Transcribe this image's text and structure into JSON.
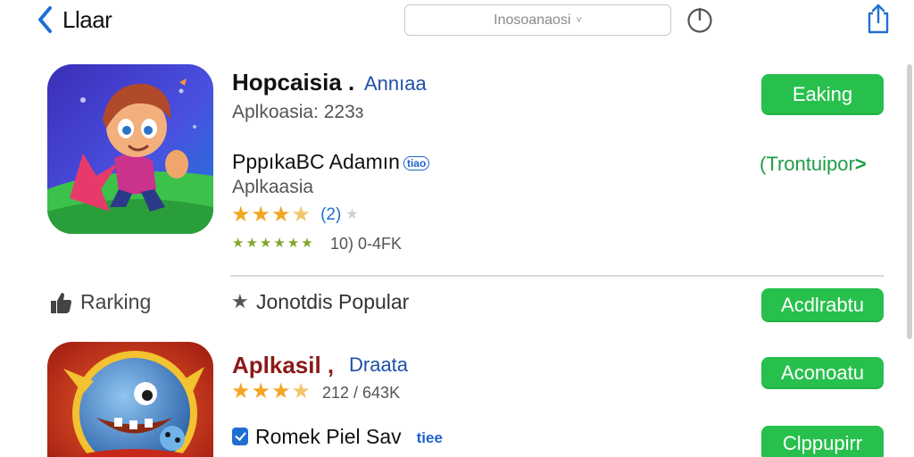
{
  "header": {
    "back_label": "Llaar",
    "search_text": "Inosoanaosi",
    "search_chevron": "˅"
  },
  "app1": {
    "title": "Hopcaisia .",
    "developer": "Annıaa",
    "category_line": "Aplkoasia: 223ɜ",
    "subtitle": "PppıkaBC Adamın",
    "badge": "tiao",
    "subcategory": "Aplkaasia",
    "rating": 3.5,
    "rating_count": "(2)",
    "stats": "10) 0-4FK",
    "get_button": "Eaking",
    "secondary_link": "(Trontuipor",
    "colors": {
      "accent_green": "#27c04d",
      "link_green": "#1e9e45"
    }
  },
  "section": {
    "label": "Rarking",
    "star_label": "Jonotdis Popular",
    "button": "Acdlrabtu"
  },
  "app2": {
    "title": "Aplkasil ,",
    "developer": "Draata",
    "rating": 3.5,
    "stats": "212 / 643K",
    "button": "Aconoatu",
    "subtitle": "Romek Piel Sav",
    "badge": "tiee",
    "button2": "Clppupirr"
  },
  "icons": {
    "back": "chevron-left-icon",
    "power": "power-icon",
    "share": "share-icon",
    "section": "thumbs-up-icon"
  }
}
